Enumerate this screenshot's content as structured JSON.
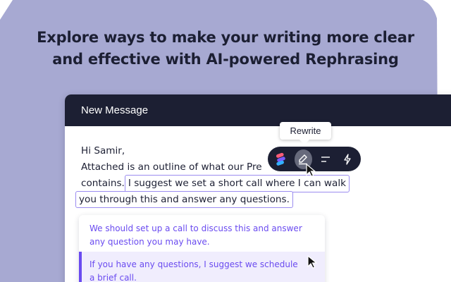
{
  "headline": {
    "line1": "Explore ways to make your writing more clear",
    "line2": "and effective with AI-powered Rephrasing"
  },
  "colors": {
    "background_shape": "#a7a9d2",
    "header_dark": "#1c1f33",
    "accent_purple": "#6a4bf0",
    "highlight_border": "#9b8cf0",
    "selected_bg": "#f0edfd"
  },
  "message_window": {
    "title": "New Message",
    "lines": {
      "greeting": "Hi Samir,",
      "line2": "Attached is an outline of what our Pre",
      "line3_lead": "contains.",
      "line3_highlight": "I suggest we set a short call where I can walk",
      "line4_highlight": "you through this and answer any questions."
    }
  },
  "tooltip": {
    "label": "Rewrite"
  },
  "toolbar": {
    "buttons": [
      {
        "icon": "app-logo-icon"
      },
      {
        "icon": "rewrite-pen-icon",
        "active": true
      },
      {
        "icon": "shorten-lines-icon"
      },
      {
        "icon": "lightning-icon"
      }
    ]
  },
  "suggestions": [
    {
      "text_line1": "We should set up a call to discuss this and answer",
      "text_line2": "any question you may have.",
      "selected": false
    },
    {
      "text_line1": "If you have any questions, I suggest we schedule",
      "text_line2": "a brief call.",
      "selected": true
    }
  ]
}
